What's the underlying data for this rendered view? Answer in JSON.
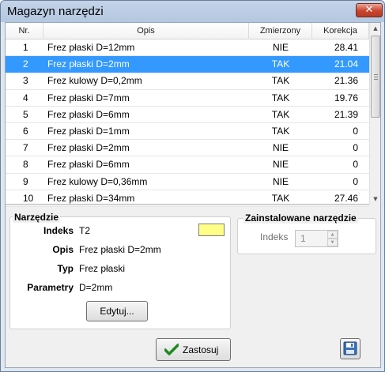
{
  "window": {
    "title": "Magazyn narzędzi",
    "close_label": "✕"
  },
  "table": {
    "headers": {
      "nr": "Nr.",
      "opis": "Opis",
      "zmierzony": "Zmierzony",
      "korekcja": "Korekcja"
    },
    "selected_index": 1,
    "rows": [
      {
        "nr": "1",
        "opis": "Frez płaski D=12mm",
        "zmierzony": "NIE",
        "korekcja": "28.41"
      },
      {
        "nr": "2",
        "opis": "Frez płaski D=2mm",
        "zmierzony": "TAK",
        "korekcja": "21.04"
      },
      {
        "nr": "3",
        "opis": "Frez kulowy D=0,2mm",
        "zmierzony": "TAK",
        "korekcja": "21.36"
      },
      {
        "nr": "4",
        "opis": "Frez płaski D=7mm",
        "zmierzony": "TAK",
        "korekcja": "19.76"
      },
      {
        "nr": "5",
        "opis": "Frez płaski D=6mm",
        "zmierzony": "TAK",
        "korekcja": "21.39"
      },
      {
        "nr": "6",
        "opis": "Frez płaski D=1mm",
        "zmierzony": "TAK",
        "korekcja": "0"
      },
      {
        "nr": "7",
        "opis": "Frez płaski D=2mm",
        "zmierzony": "NIE",
        "korekcja": "0"
      },
      {
        "nr": "8",
        "opis": "Frez płaski D=6mm",
        "zmierzony": "NIE",
        "korekcja": "0"
      },
      {
        "nr": "9",
        "opis": "Frez kulowy D=0,36mm",
        "zmierzony": "NIE",
        "korekcja": "0"
      },
      {
        "nr": "10",
        "opis": "Frez płaski D=34mm",
        "zmierzony": "TAK",
        "korekcja": "27.46"
      }
    ]
  },
  "tool_group": {
    "title": "Narzędzie",
    "indeks_label": "Indeks",
    "indeks_value": "T2",
    "swatch_color": "#ffff88",
    "opis_label": "Opis",
    "opis_value": "Frez płaski D=2mm",
    "typ_label": "Typ",
    "typ_value": "Frez płaski",
    "parametry_label": "Parametry",
    "parametry_value": "D=2mm",
    "edit_label": "Edytuj..."
  },
  "installed_group": {
    "title": "Zainstalowane narzędzie",
    "indeks_label": "Indeks",
    "indeks_value": "1"
  },
  "actions": {
    "apply_label": "Zastosuj",
    "apply_icon": "checkmark-icon",
    "save_icon": "floppy-disk-icon"
  },
  "colors": {
    "selection": "#3399ff",
    "swatch": "#ffff88",
    "check": "#1e8a1e"
  }
}
